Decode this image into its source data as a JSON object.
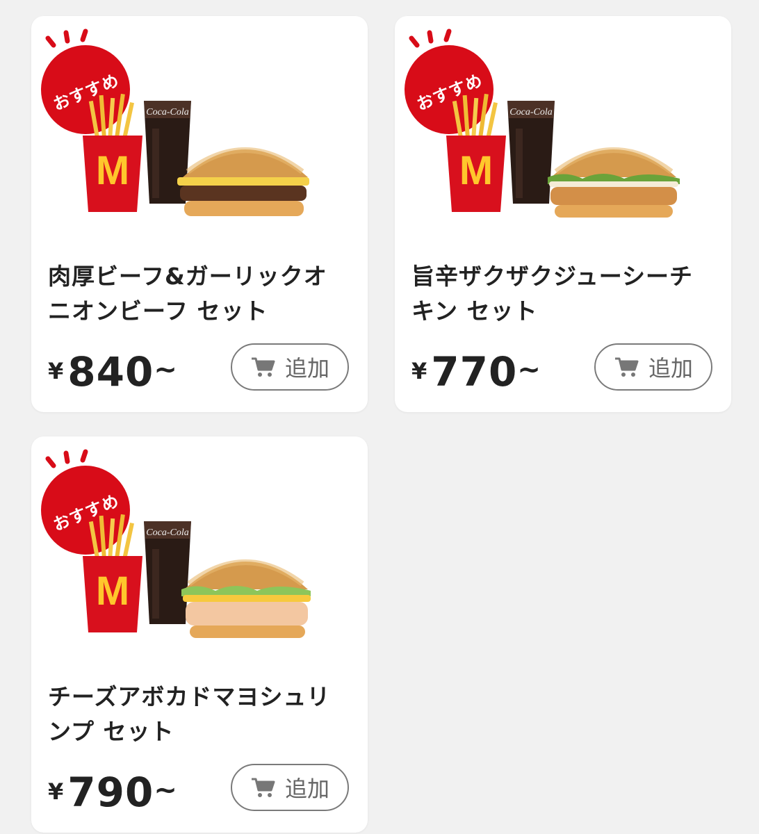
{
  "colors": {
    "badge_red": "#d80c18",
    "text": "#222222",
    "button_border": "#7a7a7a",
    "button_text": "#666666"
  },
  "badge_label": "おすすめ",
  "add_label": "追加",
  "cards": [
    {
      "badge": "おすすめ",
      "title_line1": "肉厚ビーフ&ガーリックオ",
      "title_line2": "ニオンビーフ セット",
      "currency": "¥",
      "price": "840",
      "suffix": "~",
      "add_label": "追加",
      "burger": "beef"
    },
    {
      "badge": "おすすめ",
      "title_line1": "旨辛ザクザクジューシーチ",
      "title_line2": "キン セット",
      "currency": "¥",
      "price": "770",
      "suffix": "~",
      "add_label": "追加",
      "burger": "chicken"
    },
    {
      "badge": "おすすめ",
      "title_line1": "チーズアボカドマヨシュリ",
      "title_line2": "ンプ セット",
      "currency": "¥",
      "price": "790",
      "suffix": "~",
      "add_label": "追加",
      "burger": "shrimp"
    }
  ]
}
